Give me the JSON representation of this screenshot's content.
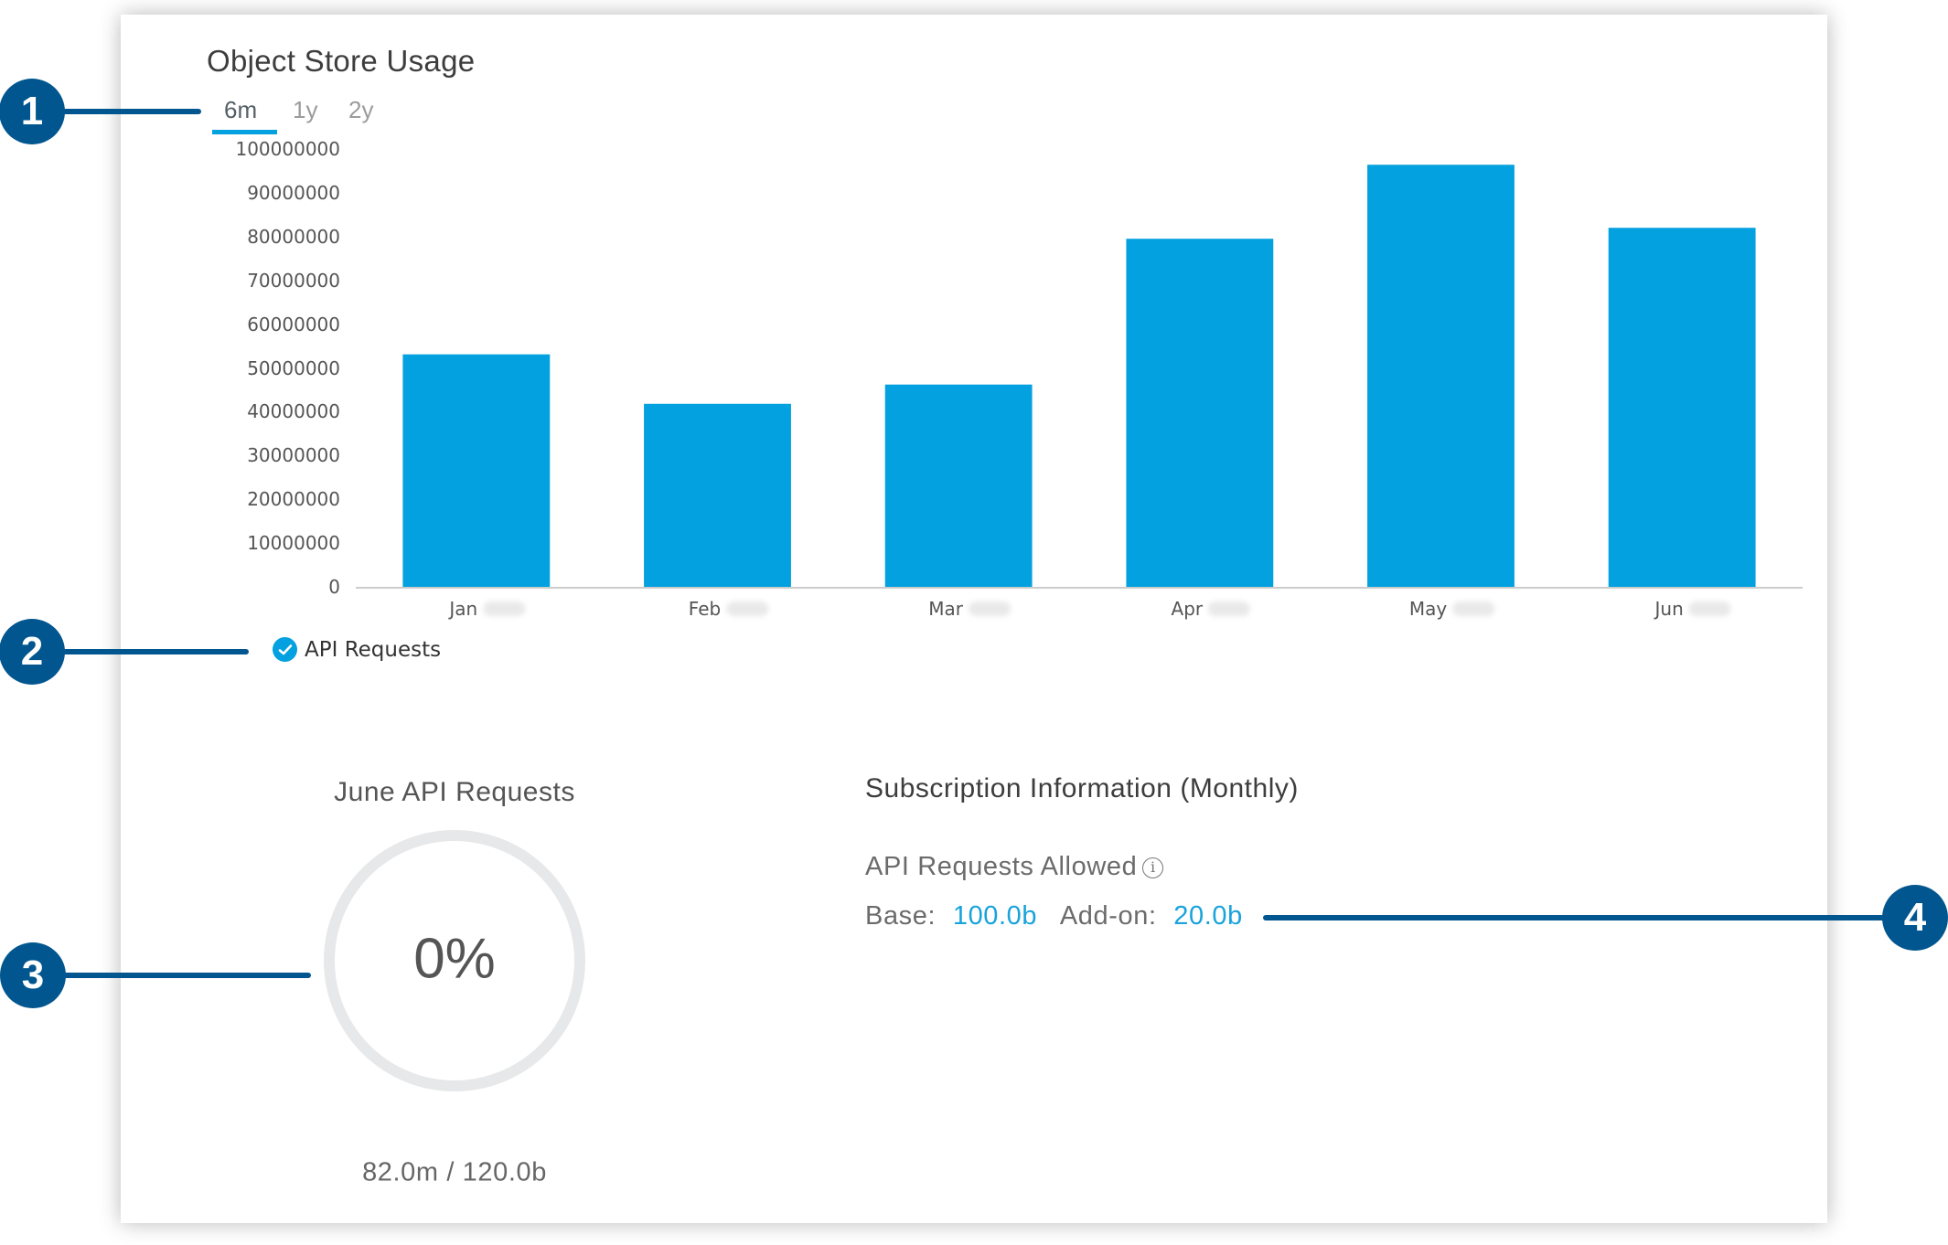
{
  "widget": {
    "title": "Object Store Usage",
    "tabs": [
      {
        "label": "6m",
        "active": true
      },
      {
        "label": "1y",
        "active": false
      },
      {
        "label": "2y",
        "active": false
      }
    ],
    "legend": {
      "label": "API Requests",
      "checked": true
    }
  },
  "chart_data": {
    "type": "bar",
    "title": "Object Store Usage",
    "xlabel": "",
    "ylabel": "",
    "categories": [
      "Jan",
      "Feb",
      "Mar",
      "Apr",
      "May",
      "Jun"
    ],
    "series": [
      {
        "name": "API Requests",
        "color": "#03a1df",
        "values": [
          53100000,
          41800000,
          46200000,
          79500000,
          96400000,
          82000000
        ]
      }
    ],
    "yticks": [
      "0",
      "10000000",
      "20000000",
      "30000000",
      "40000000",
      "50000000",
      "60000000",
      "70000000",
      "80000000",
      "90000000",
      "100000000"
    ],
    "ylim": [
      0,
      100000000
    ],
    "grid": false,
    "legend_position": "bottom-left"
  },
  "gauge": {
    "title": "June API Requests",
    "percent_label": "0%",
    "percent_value": 0,
    "usage": "82.0m / 120.0b"
  },
  "subscription": {
    "title": "Subscription Information (Monthly)",
    "allowed_label": "API Requests Allowed",
    "info_icon": "i",
    "base_label": "Base:",
    "base_value": "100.0b",
    "addon_label": "Add-on:",
    "addon_value": "20.0b"
  },
  "callouts": [
    "1",
    "2",
    "3",
    "4"
  ],
  "colors": {
    "accent": "#03a1df",
    "callout": "#02568f",
    "gauge_track": "#e7e8e9"
  }
}
